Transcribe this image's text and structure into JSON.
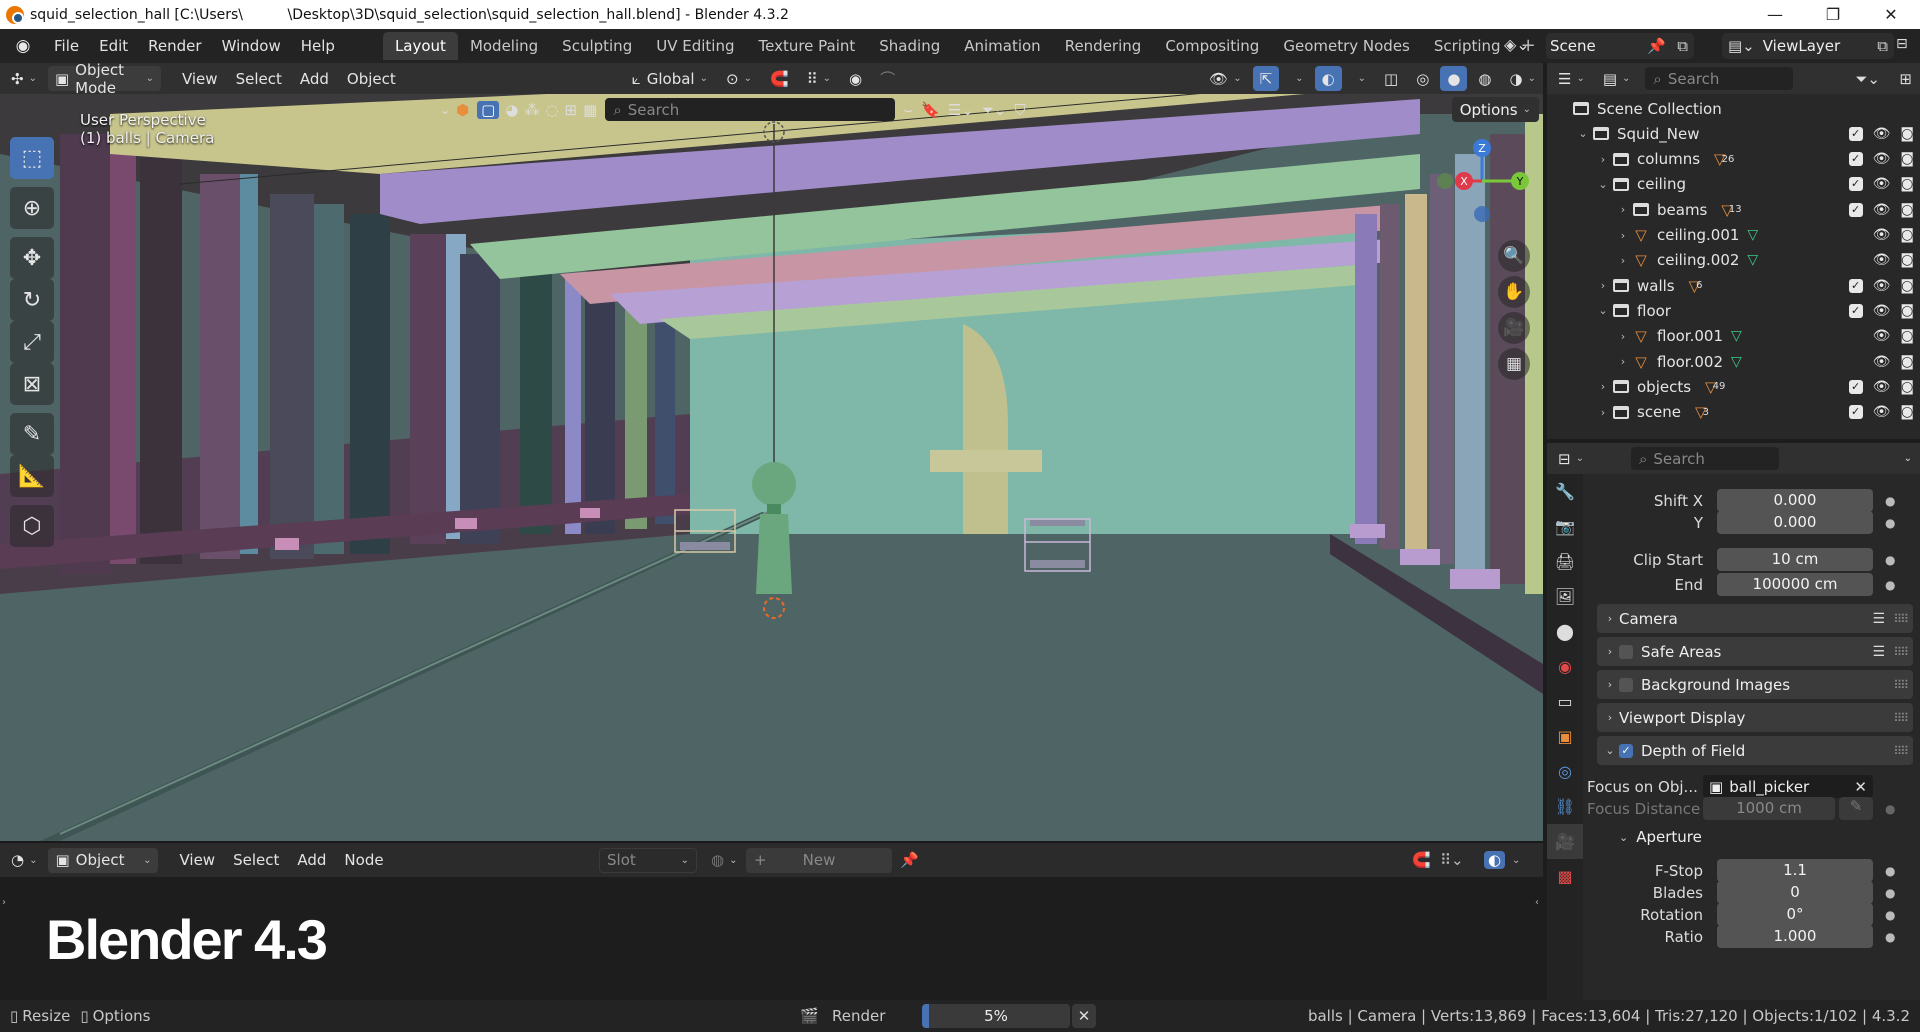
{
  "titlebar": {
    "title": "squid_selection_hall [C:\\Users\\          \\Desktop\\3D\\squid_selection\\squid_selection_hall.blend] - Blender 4.3.2",
    "minimize": "—",
    "maximize": "❐",
    "close": "✕"
  },
  "menu": [
    "File",
    "Edit",
    "Render",
    "Window",
    "Help"
  ],
  "workspaces": [
    "Layout",
    "Modeling",
    "Sculpting",
    "UV Editing",
    "Texture Paint",
    "Shading",
    "Animation",
    "Rendering",
    "Compositing",
    "Geometry Nodes",
    "Scripting"
  ],
  "active_workspace": "Layout",
  "scene_name": "Scene",
  "view_layer": "ViewLayer",
  "viewport": {
    "mode": "Object Mode",
    "menus": [
      "View",
      "Select",
      "Add",
      "Object"
    ],
    "orientation": "Global",
    "search_placeholder": "Search",
    "options": "Options",
    "perspective_label": "User Perspective",
    "object_label": "(1) balls | Camera",
    "gizmo_axes": {
      "x": "X",
      "y": "Y",
      "z": "Z"
    }
  },
  "shader_editor": {
    "mode": "Object",
    "menus": [
      "View",
      "Select",
      "Add",
      "Node"
    ],
    "slot": "Slot",
    "new_label": "New",
    "overlay_text": "Blender 4.3"
  },
  "statusbar": {
    "resize": "Resize",
    "options": "Options",
    "render_label": "Render",
    "progress_text": "5%",
    "progress_fraction": 0.05,
    "stats": "balls | Camera | Verts:13,869 | Faces:13,604 | Tris:27,120 | Objects:1/102 | 4.3.2"
  },
  "outliner": {
    "search_placeholder": "Search",
    "rows": [
      {
        "label": "Scene Collection",
        "depth": 0,
        "type": "scene",
        "twisty": ""
      },
      {
        "label": "Squid_New",
        "depth": 1,
        "type": "collection",
        "twisty": "⌄",
        "check": true
      },
      {
        "label": "columns",
        "depth": 2,
        "type": "collection",
        "twisty": "›",
        "check": true,
        "badge": "26"
      },
      {
        "label": "ceiling",
        "depth": 2,
        "type": "collection",
        "twisty": "⌄",
        "check": true
      },
      {
        "label": "beams",
        "depth": 3,
        "type": "collection",
        "twisty": "›",
        "check": true,
        "badge": "13"
      },
      {
        "label": "ceiling.001",
        "depth": 3,
        "type": "mesh",
        "twisty": "›",
        "check": false
      },
      {
        "label": "ceiling.002",
        "depth": 3,
        "type": "mesh",
        "twisty": "›",
        "check": false
      },
      {
        "label": "walls",
        "depth": 2,
        "type": "collection",
        "twisty": "›",
        "check": true,
        "badge": "6"
      },
      {
        "label": "floor",
        "depth": 2,
        "type": "collection",
        "twisty": "⌄",
        "check": true
      },
      {
        "label": "floor.001",
        "depth": 3,
        "type": "mesh",
        "twisty": "›",
        "check": false
      },
      {
        "label": "floor.002",
        "depth": 3,
        "type": "mesh",
        "twisty": "›",
        "check": false
      },
      {
        "label": "objects",
        "depth": 2,
        "type": "collection",
        "twisty": "›",
        "check": true,
        "badge": "49"
      },
      {
        "label": "scene",
        "depth": 2,
        "type": "collection",
        "twisty": "›",
        "check": true,
        "badge": "3"
      }
    ]
  },
  "properties": {
    "search_placeholder": "Search",
    "fields": {
      "shift_x_label": "Shift X",
      "shift_x": "0.000",
      "shift_y_label": "Y",
      "shift_y": "0.000",
      "clip_start_label": "Clip Start",
      "clip_start": "10 cm",
      "clip_end_label": "End",
      "clip_end": "100000 cm"
    },
    "panels": {
      "camera": "Camera",
      "safe_areas": "Safe Areas",
      "background_images": "Background Images",
      "viewport_display": "Viewport Display",
      "depth_of_field": "Depth of Field",
      "aperture": "Aperture"
    },
    "dof": {
      "focus_obj_label": "Focus on Obj...",
      "focus_obj": "ball_picker",
      "focus_distance_label": "Focus Distance",
      "focus_distance": "1000 cm"
    },
    "aperture": {
      "fstop_label": "F-Stop",
      "fstop": "1.1",
      "blades_label": "Blades",
      "blades": "0",
      "rotation_label": "Rotation",
      "rotation": "0°",
      "ratio_label": "Ratio",
      "ratio": "1.000"
    }
  },
  "colors": {
    "accent": "#4772b3",
    "floor": "#4f6565",
    "back_wall": "#7fb8a8",
    "beam_yellow": "#c8c58c",
    "beam_purple": "#9f8cc8",
    "beam_green": "#93c49b",
    "beam_pink": "#c895a5"
  }
}
